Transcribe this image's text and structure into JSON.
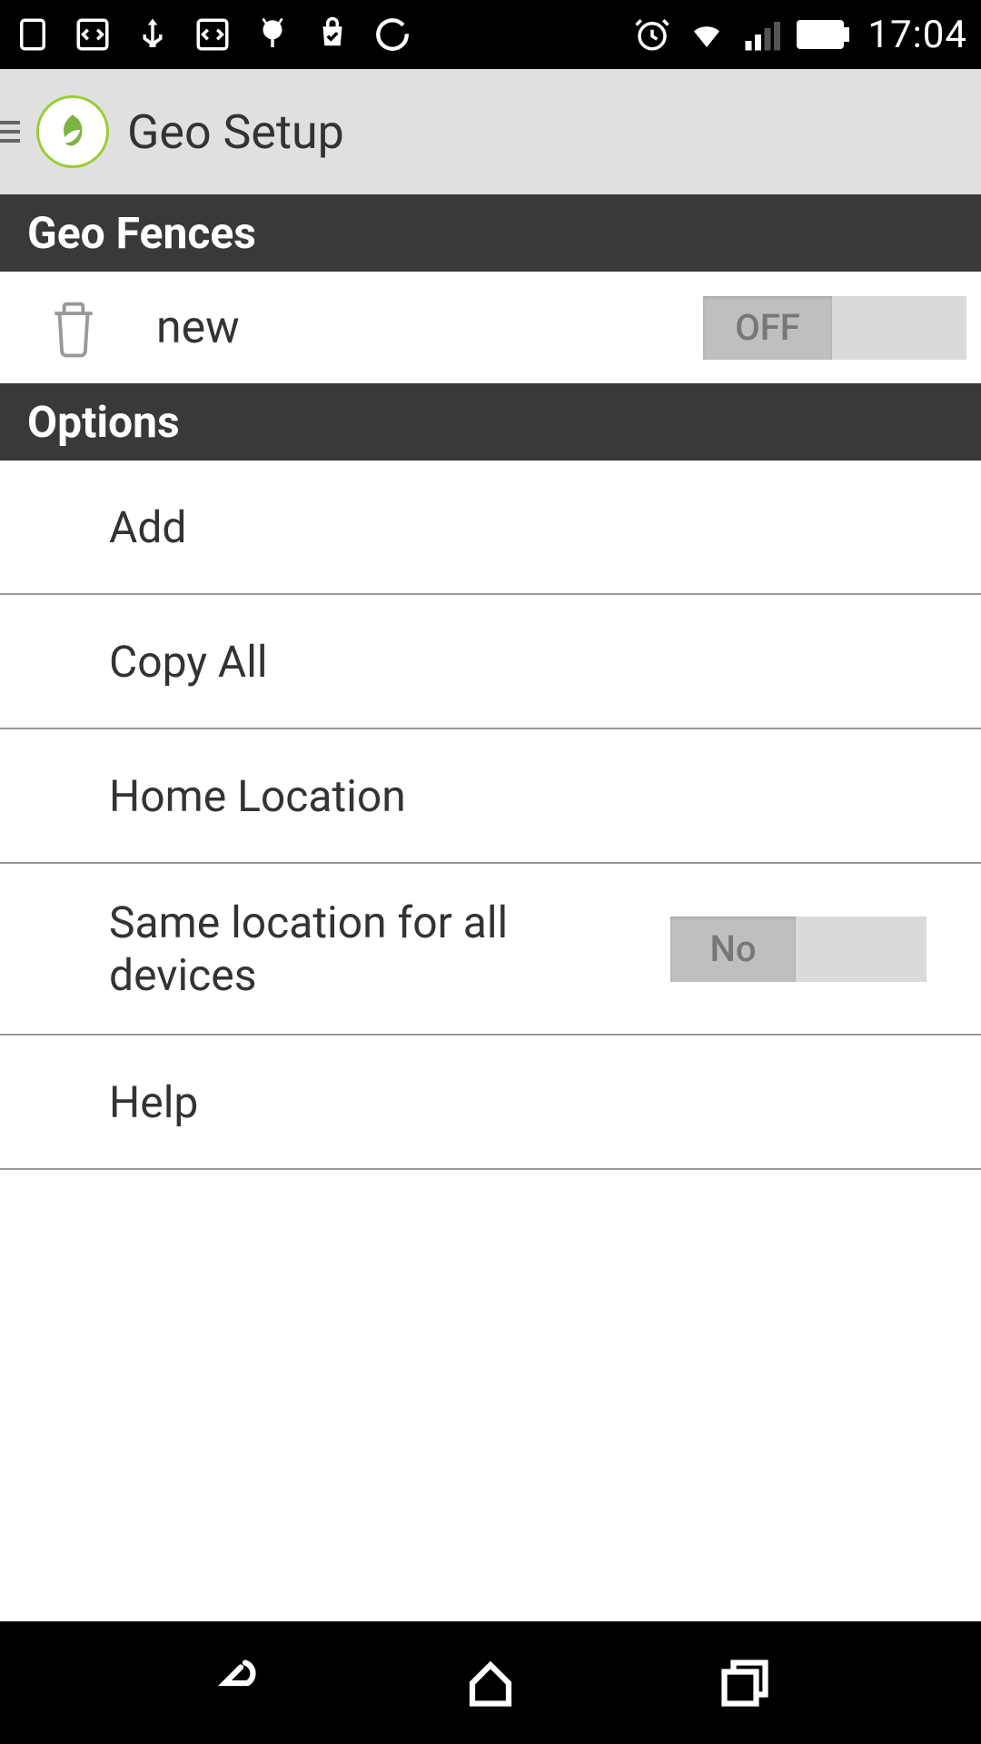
{
  "status": {
    "time": "17:04"
  },
  "header": {
    "title": "Geo Setup"
  },
  "sections": {
    "geofences_header": "Geo Fences",
    "options_header": "Options"
  },
  "fences": [
    {
      "name": "new",
      "toggle": "OFF"
    }
  ],
  "options": {
    "add": "Add",
    "copy_all": "Copy All",
    "home_location": "Home Location",
    "same_location": "Same location for all devices",
    "same_location_toggle": "No",
    "help": "Help"
  }
}
